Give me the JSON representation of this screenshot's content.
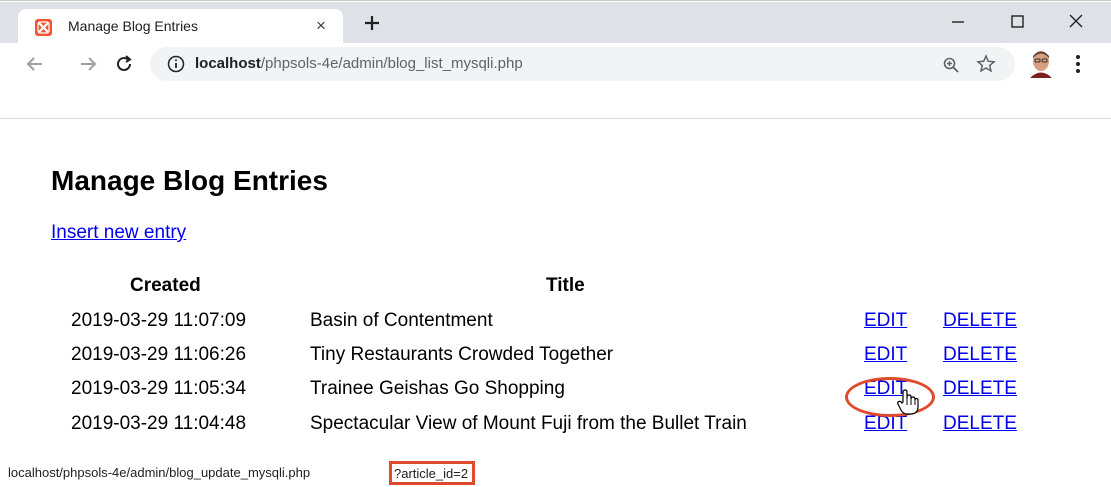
{
  "browser": {
    "tab": {
      "title": "Manage Blog Entries",
      "close_glyph": "×",
      "favicon": "xampp-icon"
    },
    "new_tab_icon": "plus-icon",
    "window_controls": [
      "minimize-icon",
      "maximize-icon",
      "close-icon"
    ],
    "address_bar": {
      "host": "localhost",
      "path": "/phpsols-4e/admin/blog_list_mysqli.php"
    },
    "toolbar_icons": [
      "back-icon",
      "forward-icon",
      "reload-icon",
      "info-icon",
      "zoom-icon",
      "star-icon",
      "avatar",
      "menu-icon"
    ]
  },
  "page": {
    "heading": "Manage Blog Entries",
    "insert_link": "Insert new entry",
    "table": {
      "headers": {
        "created": "Created",
        "title": "Title"
      },
      "rows": [
        {
          "created": "2019-03-29 11:07:09",
          "title": "Basin of Contentment",
          "edit": "EDIT",
          "delete": "DELETE"
        },
        {
          "created": "2019-03-29 11:06:26",
          "title": "Tiny Restaurants Crowded Together",
          "edit": "EDIT",
          "delete": "DELETE"
        },
        {
          "created": "2019-03-29 11:05:34",
          "title": "Trainee Geishas Go Shopping",
          "edit": "EDIT",
          "delete": "DELETE"
        },
        {
          "created": "2019-03-29 11:04:48",
          "title": "Spectacular View of Mount Fuji from the Bullet Train",
          "edit": "EDIT",
          "delete": "DELETE"
        }
      ]
    }
  },
  "status_bar": {
    "url": "localhost/phpsols-4e/admin/blog_update_mysqli.php",
    "query": "?article_id=2"
  },
  "colors": {
    "link": "#0000ee",
    "highlight": "#e04a2c",
    "tabstrip": "#dee1e6",
    "omnibox": "#f1f3f4"
  }
}
